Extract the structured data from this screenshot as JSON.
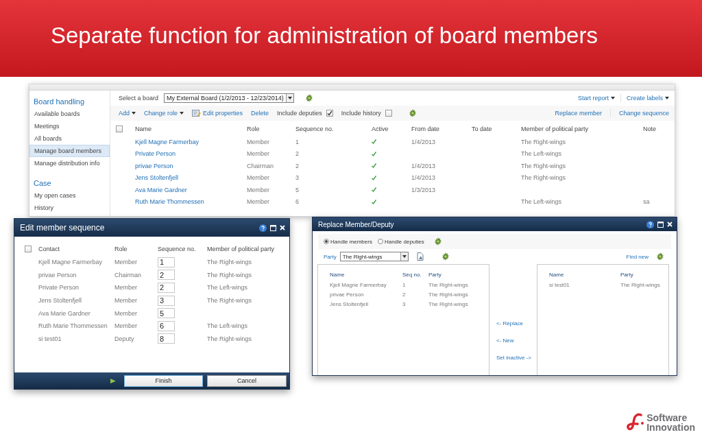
{
  "slide": {
    "title": "Separate function for administration of board members"
  },
  "board_window": {
    "sidebar": [
      {
        "heading": "Board handling",
        "items": [
          {
            "label": "Available boards",
            "selected": false
          },
          {
            "label": "Meetings",
            "selected": false
          },
          {
            "label": "All boards",
            "selected": false
          },
          {
            "label": "Manage board members",
            "selected": true
          },
          {
            "label": "Manage distribution info",
            "selected": false
          }
        ]
      },
      {
        "heading": "Case",
        "items": [
          {
            "label": "My open cases",
            "selected": false
          },
          {
            "label": "History",
            "selected": false
          }
        ]
      }
    ],
    "board_select": {
      "label": "Select a board",
      "value": "My External Board (1/2/2013 - 12/23/2014)"
    },
    "report_actions": [
      {
        "label": "Start report"
      },
      {
        "label": "Create labels"
      }
    ],
    "toolbar": [
      {
        "kind": "menu",
        "label": "Add"
      },
      {
        "kind": "menu",
        "label": "Change role"
      },
      {
        "kind": "edit",
        "label": "Edit properties"
      },
      {
        "kind": "link",
        "label": "Delete"
      },
      {
        "kind": "checkbox",
        "label": "Include deputies",
        "checked": true
      },
      {
        "kind": "checkbox",
        "label": "Include history",
        "checked": false
      },
      {
        "kind": "refresh"
      }
    ],
    "toolbar_right": [
      "Replace member",
      "Change sequence"
    ],
    "table": {
      "all_checked": false,
      "columns": [
        "Name",
        "Role",
        "Sequence no.",
        "Active",
        "From date",
        "To date",
        "Member of political party",
        "Note"
      ],
      "rows": [
        {
          "name": "Kjell Magne Farmerbay",
          "role": "Member",
          "sequence": "1",
          "active": true,
          "from": "1/4/2013",
          "party": "The Right-wings"
        },
        {
          "name": "Private Person",
          "role": "Member",
          "sequence": "2",
          "active": true,
          "party": "The Left-wings"
        },
        {
          "name": "privae Person",
          "role": "Chairman",
          "sequence": "2",
          "active": true,
          "from": "1/4/2013",
          "party": "The Right-wings"
        },
        {
          "name": "Jens Stoltenfjell",
          "role": "Member",
          "sequence": "3",
          "active": true,
          "from": "1/4/2013",
          "party": "The Right-wings"
        },
        {
          "name": "Ava Marie Gardner",
          "role": "Member",
          "sequence": "5",
          "active": true,
          "from": "1/3/2013"
        },
        {
          "name": "Ruth Marie Thommessen",
          "role": "Member",
          "sequence": "6",
          "active": true,
          "party": "The Left-wings",
          "note": "sa"
        }
      ]
    }
  },
  "sequence_dialog": {
    "title": "Edit member sequence",
    "all_checked": false,
    "columns": [
      "Contact",
      "Role",
      "Sequence no.",
      "Member of political party"
    ],
    "rows": [
      {
        "contact": "Kjell Magne Farmerbay",
        "role": "Member",
        "sequence": "1",
        "party": "The Right-wings"
      },
      {
        "contact": "privae Person",
        "role": "Chairman",
        "sequence": "2",
        "party": "The Right-wings"
      },
      {
        "contact": "Private Person",
        "role": "Member",
        "sequence": "2",
        "party": "The Left-wings"
      },
      {
        "contact": "Jens Stoltenfjell",
        "role": "Member",
        "sequence": "3",
        "party": "The Right-wings"
      },
      {
        "contact": "Ava Marie Gardner",
        "role": "Member",
        "sequence": "5"
      },
      {
        "contact": "Ruth Marie Thommessen",
        "role": "Member",
        "sequence": "6",
        "party": "The Left-wings"
      },
      {
        "contact": "si test01",
        "role": "Deputy",
        "sequence": "8",
        "party": "The Right-wings"
      }
    ],
    "buttons": [
      "Finish",
      "Cancel"
    ]
  },
  "replace_dialog": {
    "title": "Replace Member/Deputy",
    "modes": [
      {
        "label": "Handle members",
        "selected": true
      },
      {
        "label": "Handle deputies",
        "selected": false
      }
    ],
    "party_label": "Party",
    "party_value": "The Right-wings",
    "find_new": "Find new",
    "left_columns": [
      "Name",
      "Seq no.",
      "Party"
    ],
    "left_rows": [
      {
        "name": "Kjell Magne Farmerbay",
        "seq": "1",
        "party": "The Right-wings"
      },
      {
        "name": "privae Person",
        "seq": "2",
        "party": "The Right-wings"
      },
      {
        "name": "Jens Stoltenfjell",
        "seq": "3",
        "party": "The Right-wings"
      }
    ],
    "actions": [
      "<- Replace",
      "<- New",
      "Set inactive ->"
    ],
    "right_columns": [
      "Name",
      "Party"
    ],
    "right_rows": [
      {
        "name": "si test01",
        "party": "The Right-wings"
      }
    ]
  },
  "logo": {
    "line_1": "Software",
    "line_2": "Innovation"
  }
}
